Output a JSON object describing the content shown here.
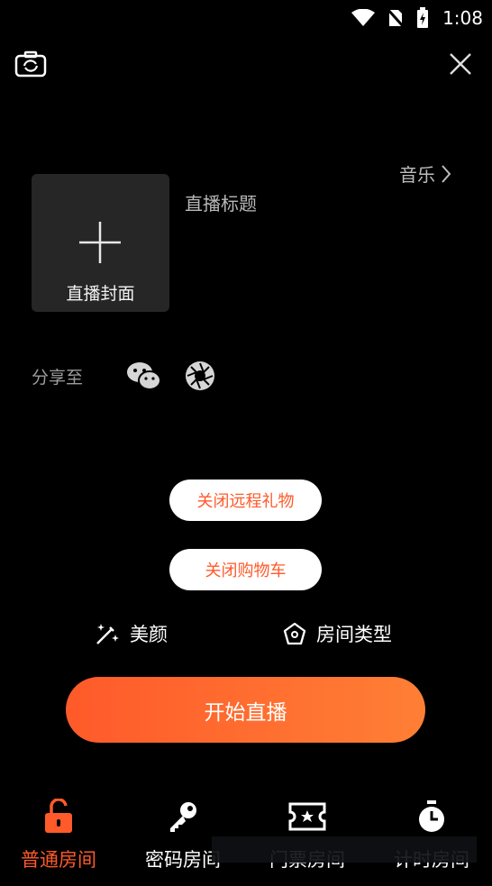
{
  "status_bar": {
    "time": "1:08"
  },
  "cover": {
    "label": "直播封面"
  },
  "title_placeholder": "直播标题",
  "music": {
    "label": "音乐"
  },
  "share": {
    "label": "分享至"
  },
  "buttons": {
    "close_remote_gifts": "关闭远程礼物",
    "close_cart": "关闭购物车",
    "start_live": "开始直播"
  },
  "options": {
    "beauty": "美颜",
    "room_type": "房间类型"
  },
  "bottom_nav": [
    {
      "label": "普通房间",
      "icon": "unlock-icon",
      "active": true
    },
    {
      "label": "密码房间",
      "icon": "key-icon",
      "active": false
    },
    {
      "label": "门票房间",
      "icon": "ticket-icon",
      "active": false
    },
    {
      "label": "计时房间",
      "icon": "timer-icon",
      "active": false
    }
  ],
  "colors": {
    "accent": "#ff5a2a",
    "background": "#000000",
    "cover_bg": "#262626"
  }
}
